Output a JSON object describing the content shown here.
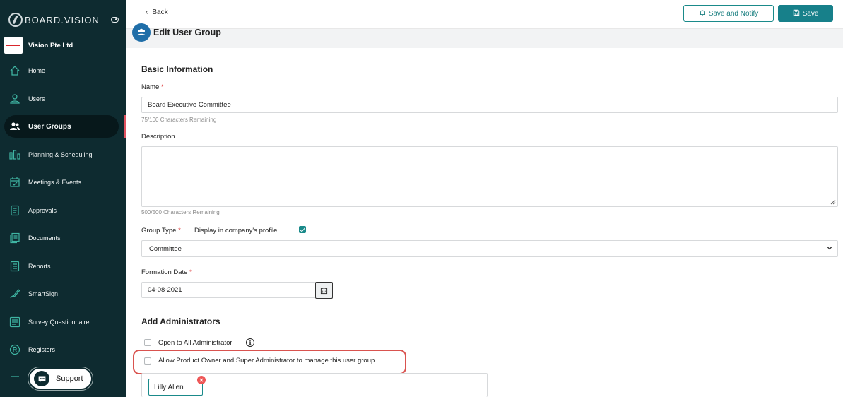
{
  "brand": {
    "name": "BOARD.VISION"
  },
  "company": {
    "name": "Vision Pte Ltd"
  },
  "nav": {
    "items": [
      {
        "label": "Home",
        "icon": "home-icon"
      },
      {
        "label": "Users",
        "icon": "user-icon"
      },
      {
        "label": "User Groups",
        "icon": "users-group-icon",
        "active": true
      },
      {
        "label": "Planning & Scheduling",
        "icon": "planning-bars-icon"
      },
      {
        "label": "Meetings & Events",
        "icon": "calendar-check-icon"
      },
      {
        "label": "Approvals",
        "icon": "approvals-doc-icon"
      },
      {
        "label": "Documents",
        "icon": "documents-icon"
      },
      {
        "label": "Reports",
        "icon": "reports-icon"
      },
      {
        "label": "SmartSign",
        "icon": "signature-pen-icon"
      },
      {
        "label": "Survey Questionnaire",
        "icon": "survey-list-icon"
      },
      {
        "label": "Registers",
        "icon": "registered-r-icon"
      }
    ]
  },
  "support": {
    "label": "Support"
  },
  "toolbar": {
    "back_label": "Back",
    "save_notify_label": "Save and Notify",
    "save_label": "Save"
  },
  "page": {
    "title": "Edit User Group"
  },
  "form": {
    "basic_info_title": "Basic Information",
    "name_label": "Name",
    "name_required": "*",
    "name_value": "Board Executive Committee",
    "name_hint": "75/100 Characters Remaining",
    "description_label": "Description",
    "description_value": "",
    "description_hint": "500/500 Characters Remaining",
    "group_type_label": "Group Type",
    "group_type_required": "*",
    "display_profile_label": "Display in company's profile",
    "display_profile_checked": true,
    "group_type_value": "Committee",
    "formation_date_label": "Formation Date",
    "formation_date_required": "*",
    "formation_date_value": "04-08-2021"
  },
  "administrators": {
    "title": "Add Administrators",
    "open_all_label": "Open to All Administrator",
    "open_all_checked": false,
    "allow_owner_label": "Allow Product Owner and Super Administrator to manage this user group",
    "allow_owner_checked": false,
    "selected": [
      {
        "name": "Lilly Allen"
      }
    ]
  },
  "colors": {
    "sidebar_bg": "#0e2b30",
    "accent": "#17808a",
    "highlight": "#d9534f",
    "active_marker": "#e05260"
  }
}
